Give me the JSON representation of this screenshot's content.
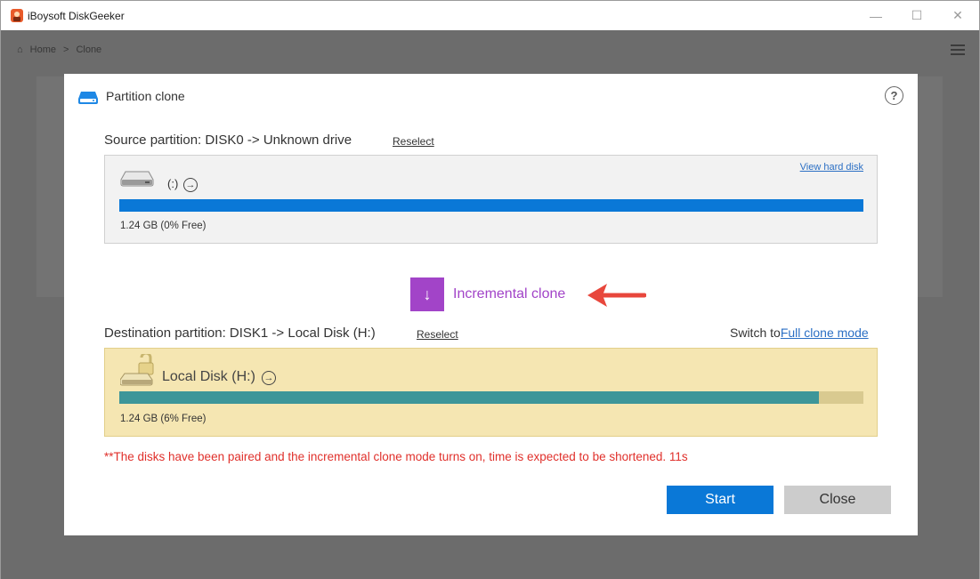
{
  "window": {
    "title": "iBoysoft DiskGeeker",
    "min_glyph": "—",
    "max_glyph": "☐",
    "close_glyph": "✕"
  },
  "background": {
    "nav_home": "Home",
    "nav_sep": ">",
    "nav_current": "Clone"
  },
  "dialog": {
    "title": "Partition clone",
    "help": "?",
    "source": {
      "label": "Source partition: DISK0 -> Unknown drive",
      "reselect": "Reselect",
      "view_hard_disk": "View hard disk",
      "partition_name": "(:)",
      "size_text": "1.24 GB (0% Free)",
      "used_fraction": 1.0,
      "icon": "hard-drive-icon"
    },
    "mode": {
      "icon": "arrow-down-icon",
      "label": "Incremental clone"
    },
    "destination": {
      "label": "Destination partition: DISK1 -> Local Disk (H:)",
      "reselect": "Reselect",
      "switch_to": "Switch to",
      "full_clone_mode": "Full clone mode",
      "partition_name": "Local Disk (H:)",
      "size_text": "1.24 GB (6% Free)",
      "used_fraction": 0.94,
      "icon": "locked-drive-icon"
    },
    "notice": "**The disks have been paired and the incremental clone mode turns on, time is expected to be shortened. 11s",
    "buttons": {
      "start": "Start",
      "close": "Close"
    }
  },
  "colors": {
    "accent_blue": "#0a78d7",
    "mode_purple": "#a244c8",
    "notice_red": "#e0302b",
    "dest_bg": "#f5e6b2",
    "dest_fill": "#3d9699"
  }
}
